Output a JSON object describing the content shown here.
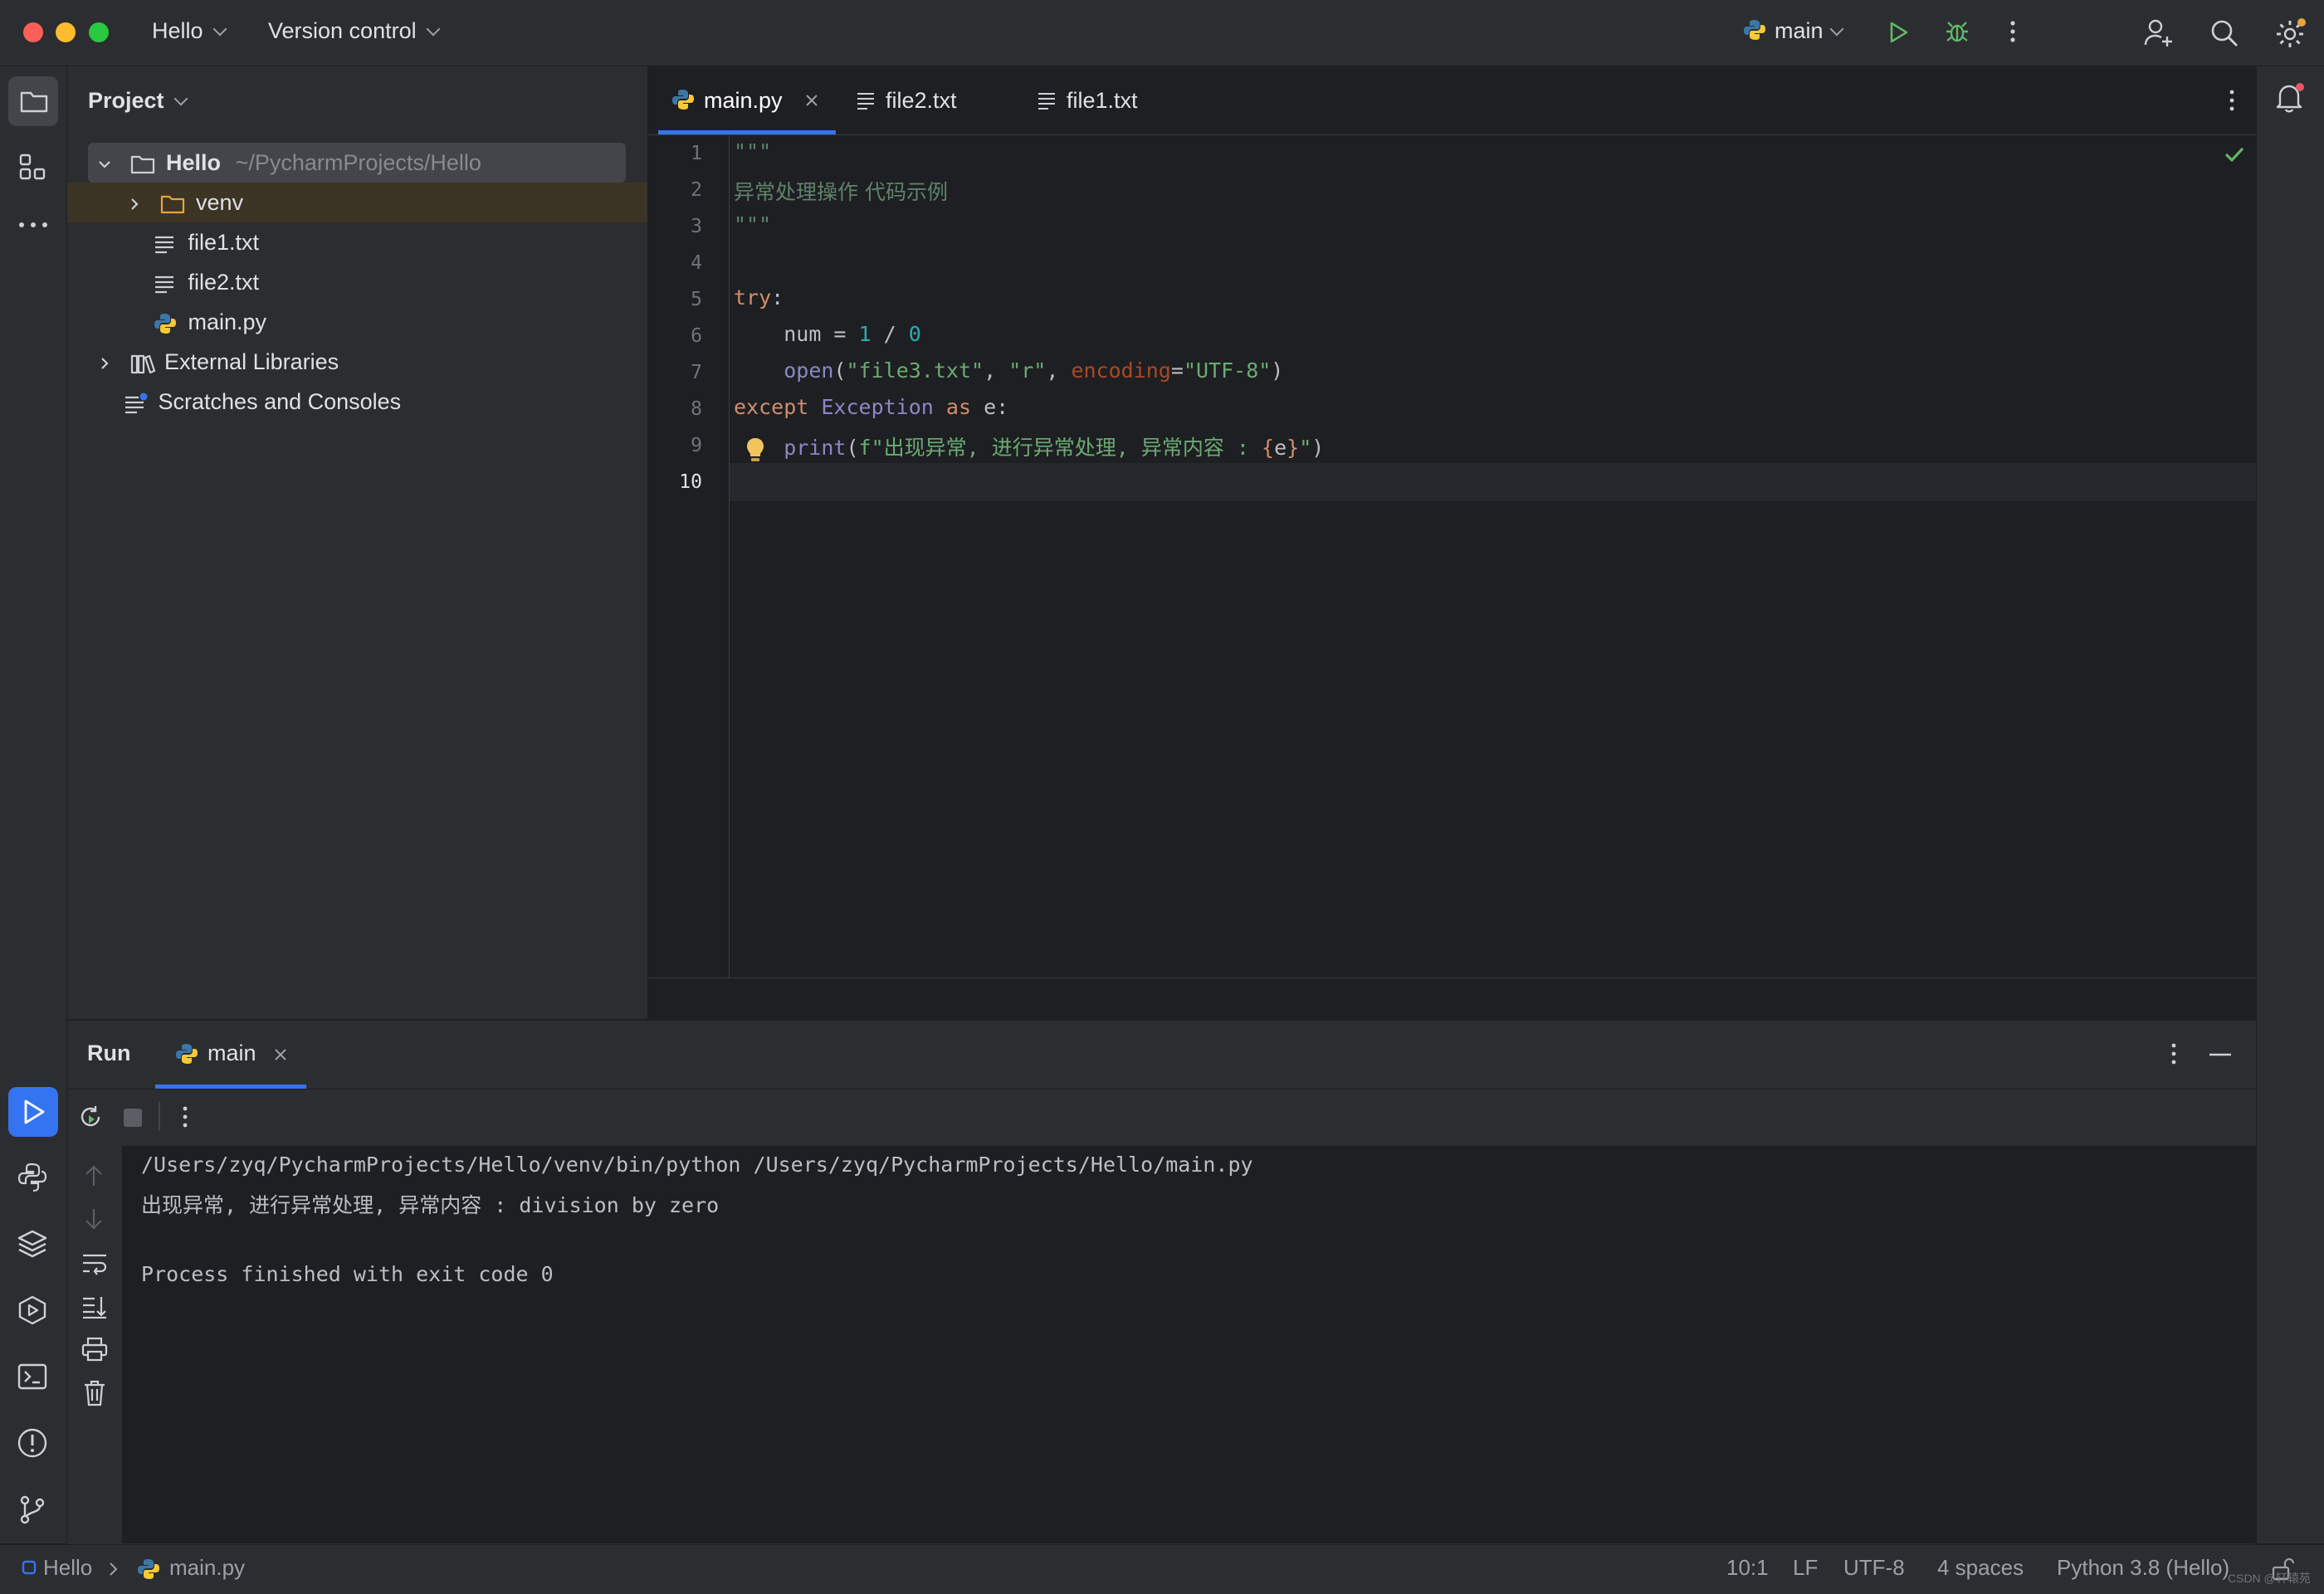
{
  "titlebar": {
    "project_name": "Hello",
    "vcs_label": "Version control",
    "run_config": "main"
  },
  "project_panel": {
    "title": "Project",
    "root_name": "Hello",
    "root_path": "~/PycharmProjects/Hello",
    "items": [
      {
        "label": "venv",
        "type": "folder"
      },
      {
        "label": "file1.txt",
        "type": "text"
      },
      {
        "label": "file2.txt",
        "type": "text"
      },
      {
        "label": "main.py",
        "type": "python"
      }
    ],
    "external_libraries": "External Libraries",
    "scratches": "Scratches and Consoles"
  },
  "editor": {
    "tabs": [
      {
        "label": "main.py",
        "active": true
      },
      {
        "label": "file2.txt",
        "active": false
      },
      {
        "label": "file1.txt",
        "active": false
      }
    ],
    "line_numbers": [
      "1",
      "2",
      "3",
      "4",
      "5",
      "6",
      "7",
      "8",
      "9",
      "10"
    ],
    "current_line": "10",
    "code": {
      "l1": "\"\"\"",
      "l2": "异常处理操作 代码示例",
      "l3": "\"\"\"",
      "l5_kw": "try",
      "l5_colon": ":",
      "l6_var": "num = ",
      "l6_n1": "1",
      "l6_op": " / ",
      "l6_n2": "0",
      "l7_fn": "open",
      "l7_p1": "(",
      "l7_s1": "\"file3.txt\"",
      "l7_c1": ", ",
      "l7_s2": "\"r\"",
      "l7_c2": ", ",
      "l7_param": "encoding",
      "l7_eq": "=",
      "l7_s3": "\"UTF-8\"",
      "l7_p2": ")",
      "l8_kw": "except",
      "l8_cls": "Exception",
      "l8_as": "as",
      "l8_rest": " e:",
      "l9_fn": "print",
      "l9_p1": "(",
      "l9_s1": "f\"出现异常, 进行异常处理, 异常内容 : ",
      "l9_b1": "{",
      "l9_e": "e",
      "l9_b2": "}",
      "l9_s2": "\"",
      "l9_p2": ")"
    }
  },
  "run_panel": {
    "title": "Run",
    "tab_label": "main",
    "output": [
      "/Users/zyq/PycharmProjects/Hello/venv/bin/python /Users/zyq/PycharmProjects/Hello/main.py",
      "出现异常, 进行异常处理, 异常内容 : division by zero",
      "",
      "Process finished with exit code 0"
    ]
  },
  "statusbar": {
    "project": "Hello",
    "file": "main.py",
    "position": "10:1",
    "line_ending": "LF",
    "encoding": "UTF-8",
    "indent": "4 spaces",
    "interpreter": "Python 3.8 (Hello)",
    "watermark": "CSDN @轩辕苑"
  },
  "colors": {
    "accent": "#3574f0",
    "run_green": "#5fb865",
    "folder_orange": "#e8a33e",
    "selection": "#43454a"
  }
}
